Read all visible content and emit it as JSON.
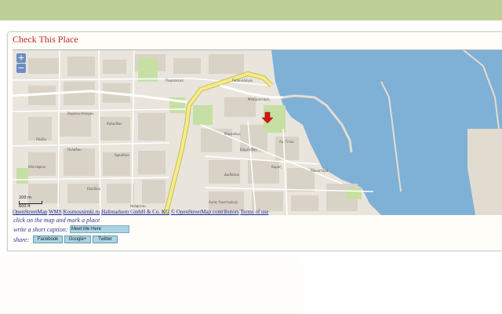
{
  "page": {
    "title": "Check This Place"
  },
  "map": {
    "zoom_in": "+",
    "zoom_out": "−",
    "scale_m": "200 m",
    "scale_ft": "600 ft",
    "marker_icon": "red-arrow-icon",
    "attribution": {
      "osm": "OpenStreetMap",
      "wms": "WMS",
      "kosmos": "Kosmosnimki.ru",
      "haltmarkern": "Haltmarkern GmbH & Co. KG",
      "contrib": "© OpenStreetMap contributors",
      "terms": "Terms of use"
    },
    "colors": {
      "water": "#7fb0d6",
      "land": "#e9e5dc",
      "highway": "#f3ec8c",
      "park": "#c6dfa4"
    },
    "labels": [
      "Παρασκευά",
      "Παλαιολόγου",
      "Βορείου Ηπείρου",
      "Πλαζα",
      "Πυλάδου",
      "Κλειδιού",
      "Κλειτοφίου",
      "Αρκαδίου",
      "Μπαϊρακτάρη",
      "Χαλκιδών",
      "Λεωφόρος Αθηνών",
      "Επιμενίδου",
      "Ιδομενέως",
      "Κοραή",
      "Δαιδάλου",
      "Αγ. Τίτου",
      "Μονής Αγκαράθου",
      "Αγίας Αικατερίνης",
      "Ρακοστόρα",
      "Νεόφυτου"
    ]
  },
  "instructions": {
    "mark": "click on the map and mark a place"
  },
  "caption": {
    "label": "write a short caption:",
    "value": "Meet Me Here"
  },
  "share": {
    "label": "share:",
    "facebook": "Facebook",
    "googleplus": "Google+",
    "twitter": "Twitter"
  }
}
